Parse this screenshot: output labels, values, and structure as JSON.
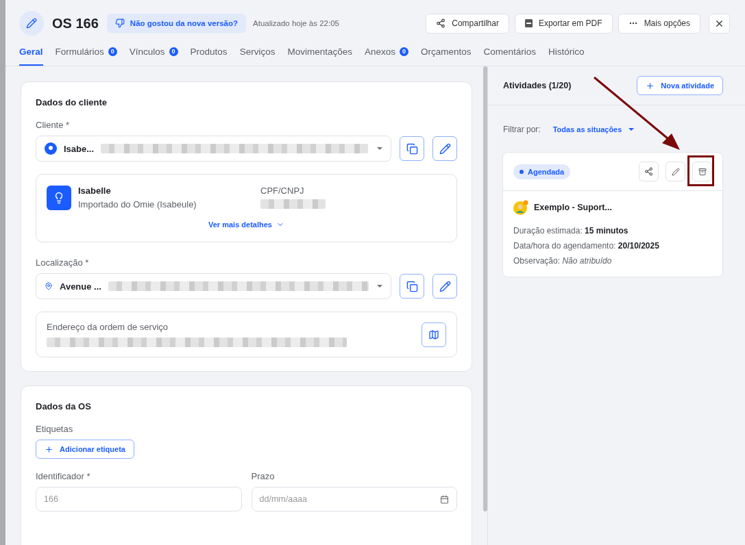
{
  "header": {
    "title": "OS 166",
    "feedback": "Não gostou da nova versão?",
    "updated": "Atualizado hoje às 22:05",
    "actions": [
      {
        "kind": "share",
        "label": "Compartilhar"
      },
      {
        "kind": "pdf",
        "label": "Exportar em PDF"
      },
      {
        "kind": "more",
        "label": "Mais opções"
      }
    ]
  },
  "tabs": [
    {
      "label": "Geral",
      "selected": true
    },
    {
      "label": "Formulários",
      "badge": "0",
      "selected": false
    },
    {
      "label": "Vínculos",
      "badge": "0",
      "selected": false
    },
    {
      "label": "Produtos",
      "selected": false
    },
    {
      "label": "Serviços",
      "selected": false
    },
    {
      "label": "Movimentações",
      "selected": false
    },
    {
      "label": "Anexos",
      "badge": "0",
      "selected": false
    },
    {
      "label": "Orçamentos",
      "selected": false
    },
    {
      "label": "Comentários",
      "selected": false
    },
    {
      "label": "Histórico",
      "selected": false
    }
  ],
  "client_section": {
    "title": "Dados do cliente",
    "client_field": {
      "label": "Cliente *",
      "value": "Isabe..."
    },
    "client_card": {
      "name": "Isabelle",
      "subtitle": "Importado do Omie (Isabeule)",
      "doc_label": "CPF/CNPJ",
      "more": "Ver mais detalhes"
    },
    "location_field": {
      "label": "Localização *",
      "value": "Avenue ..."
    },
    "address": {
      "label": "Endereço da ordem de serviço"
    }
  },
  "os_section": {
    "title": "Dados da OS",
    "tags_label": "Etiquetas",
    "add_tag": "Adicionar etiqueta",
    "identifier": {
      "label": "Identificador *",
      "placeholder": "166"
    },
    "deadline": {
      "label": "Prazo",
      "placeholder": "dd/mm/aaaa"
    }
  },
  "activities": {
    "title": "Atividades (1/20)",
    "new_button": "Nova atividade",
    "filter_label": "Filtrar por:",
    "filter_value": "Todas as situações",
    "items": [
      {
        "status": "Agendada",
        "color": "#1a5cff",
        "title": "Exemplo - Suport...",
        "fields": [
          {
            "kind": "bold",
            "label": "Duração estimada:",
            "value": "15 minutos"
          },
          {
            "kind": "bold",
            "label": "Data/hora do agendamento:",
            "value": "20/10/2025"
          },
          {
            "kind": "italic",
            "label": "Observação:",
            "value": "Não atribuído"
          }
        ]
      }
    ]
  }
}
